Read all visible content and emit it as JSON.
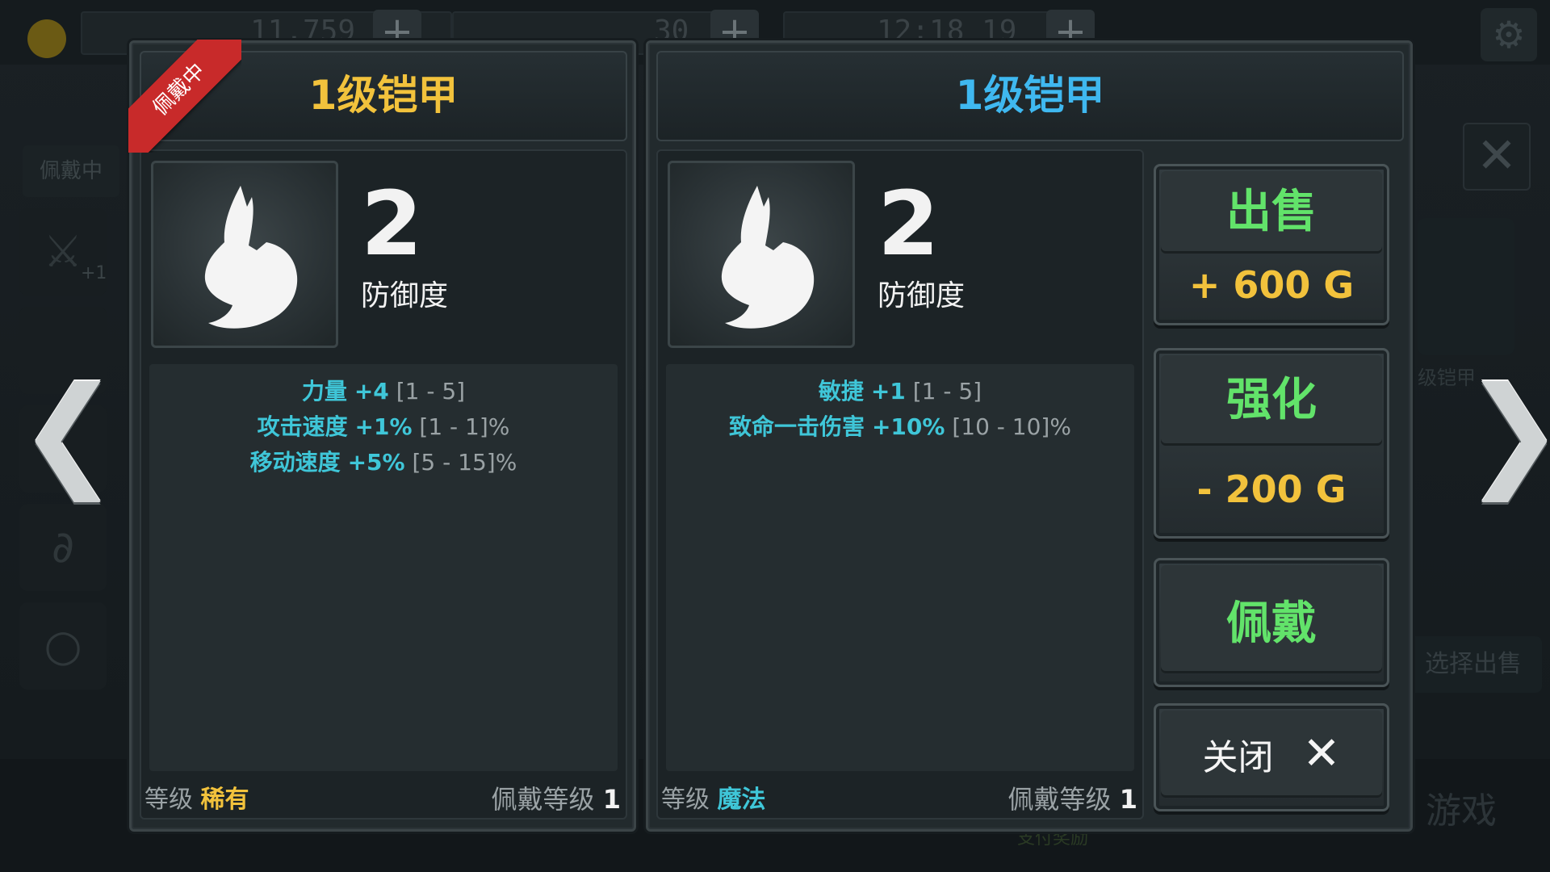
{
  "background": {
    "resources": [
      "11,759",
      "30",
      "12:18 19"
    ],
    "sidebar_label": "佩戴中",
    "sidebar_plus": "+1",
    "right_side_label": "级铠甲",
    "right_sell_label": "选择出售",
    "bottom_right": "游戏",
    "bottom_center": "支付奖励"
  },
  "nav": {
    "left": "❮",
    "right": "❯"
  },
  "equipped": {
    "ribbon": "佩戴中",
    "title": "1级铠甲",
    "defense_value": "2",
    "defense_label": "防御度",
    "stats": [
      {
        "name": "力量",
        "bonus": "+4",
        "range": "[1 - 5]"
      },
      {
        "name": "攻击速度",
        "bonus": "+1%",
        "range": "[1 - 1]%"
      },
      {
        "name": "移动速度",
        "bonus": "+5%",
        "range": "[5 - 15]%"
      }
    ],
    "grade_label": "等级",
    "grade_value": "稀有",
    "req_label": "佩戴等级",
    "req_value": "1"
  },
  "compare": {
    "title": "1级铠甲",
    "defense_value": "2",
    "defense_label": "防御度",
    "stats": [
      {
        "name": "敏捷",
        "bonus": "+1",
        "range": "[1 - 5]"
      },
      {
        "name": "致命一击伤害",
        "bonus": "+10%",
        "range": "[10 - 10]%"
      }
    ],
    "grade_label": "等级",
    "grade_value": "魔法",
    "req_label": "佩戴等级",
    "req_value": "1"
  },
  "actions": {
    "sell_label": "出售",
    "sell_cost": "+ 600 G",
    "upgrade_label": "强化",
    "upgrade_cost": "- 200 G",
    "equip_label": "佩戴",
    "close_label": "关闭",
    "close_icon": "✕"
  },
  "colors": {
    "rare": "#f2c23c",
    "magic": "#3fc6d8",
    "action_green": "#62e36a",
    "ribbon_red": "#c82a2a"
  },
  "icons": {
    "item": "armor-icon",
    "settings": "gear-icon"
  }
}
